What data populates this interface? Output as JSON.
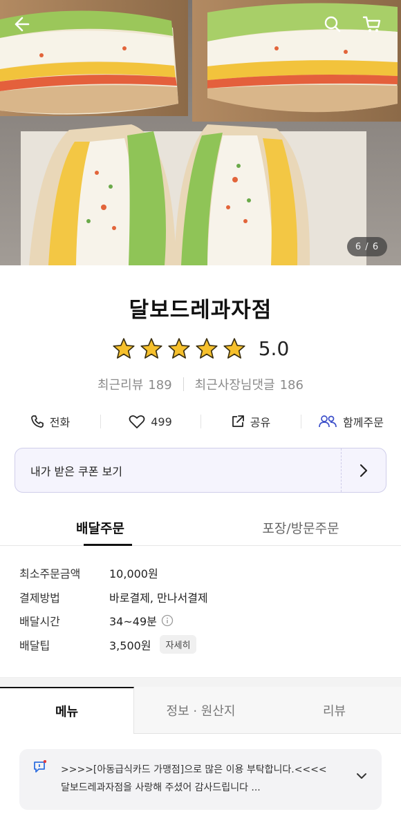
{
  "hero": {
    "image_description_icon": "sandwich-photo",
    "counter": "6 / 6"
  },
  "topbar": {
    "back_icon": "arrow-left-icon",
    "search_icon": "search-icon",
    "cart_icon": "cart-icon"
  },
  "store": {
    "name": "달보드레과자점",
    "rating": 5.0,
    "rating_text": "5.0",
    "star_count": 5,
    "star_color": "#f6c02c",
    "recent_reviews_label": "최근리뷰",
    "recent_reviews_count": "189",
    "owner_replies_label": "최근사장님댓글",
    "owner_replies_count": "186"
  },
  "actions": [
    {
      "icon": "phone-icon",
      "label": "전화"
    },
    {
      "icon": "heart-icon",
      "label": "499"
    },
    {
      "icon": "share-icon",
      "label": "공유"
    },
    {
      "icon": "group-order-icon",
      "label": "함께주문",
      "color": "#3b4ec9"
    }
  ],
  "coupon": {
    "label": "내가 받은 쿠폰 보기",
    "arrow_icon": "chevron-right-icon"
  },
  "order_tabs": [
    {
      "label": "배달주문",
      "active": true
    },
    {
      "label": "포장/방문주문",
      "active": false
    }
  ],
  "info": {
    "min_order": {
      "key": "최소주문금액",
      "value": "10,000원"
    },
    "payment": {
      "key": "결제방법",
      "value": "바로결제, 만나서결제"
    },
    "delivery_time": {
      "key": "배달시간",
      "value": "34~49분",
      "icon": "info-circle-icon"
    },
    "delivery_tip": {
      "key": "배달팁",
      "value": "3,500원",
      "chip": "자세히"
    }
  },
  "menu_tabs": [
    {
      "label": "메뉴",
      "active": true
    },
    {
      "label": "정보 · 원산지",
      "active": false
    },
    {
      "label": "리뷰",
      "active": false
    }
  ],
  "notice": {
    "icon": "megaphone-icon",
    "line1": ">>>>[아동급식카드 가맹점]으로 많은 이용 부탁합니다.<<<<",
    "line2": "달보드레과자점을 사랑해 주셨어 감사드립니다 ...",
    "chevron_icon": "chevron-down-icon"
  }
}
